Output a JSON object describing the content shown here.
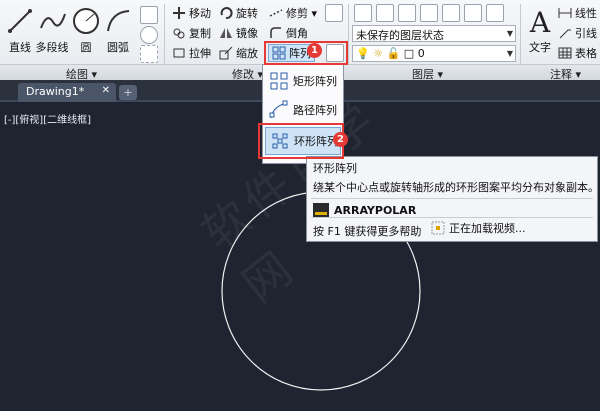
{
  "ribbon": {
    "draw": {
      "line_label": "直线",
      "polyline_label": "多段线",
      "circle_label": "圆",
      "arc_label": "圆弧",
      "panel_title": "绘图 ▾"
    },
    "modify": {
      "move_label": "移动",
      "rotate_label": "旋转",
      "trim_label": "修剪 ▾",
      "copy_label": "复制",
      "mirror_label": "镜像",
      "fillet_label": "倒角",
      "stretch_label": "拉伸",
      "scale_label": "缩放",
      "array_label": "阵列",
      "panel_title": "修改 ▾"
    },
    "layers": {
      "layer_state": "未保存的图层状态",
      "current_layer": "0",
      "panel_title": "图层 ▾"
    },
    "annotation": {
      "text_label": "文字",
      "linear_label": "线性",
      "leader_label": "引线",
      "table_label": "表格",
      "panel_title": "注释 ▾"
    }
  },
  "tabs": {
    "drawing_tab": "Drawing1*",
    "close": "✕",
    "add": "+"
  },
  "viewport": {
    "label": "[-][俯视][二维线框]"
  },
  "array_menu": {
    "items": [
      {
        "label": "矩形阵列"
      },
      {
        "label": "路径阵列"
      },
      {
        "label": "环形阵列"
      }
    ]
  },
  "tooltip": {
    "title": "环形阵列",
    "description": "绕某个中心点或旋转轴形成的环形图案平均分布对象副本。",
    "command": "ARRAYPOLAR",
    "help": "按 F1 键获得更多帮助",
    "video": "正在加载视频..."
  },
  "badges": {
    "first": "1",
    "second": "2"
  },
  "watermark": "软件自学网",
  "colors": {
    "canvas": "#1f2430",
    "highlight": "#e53935",
    "ribbon": "#eef0f3"
  }
}
